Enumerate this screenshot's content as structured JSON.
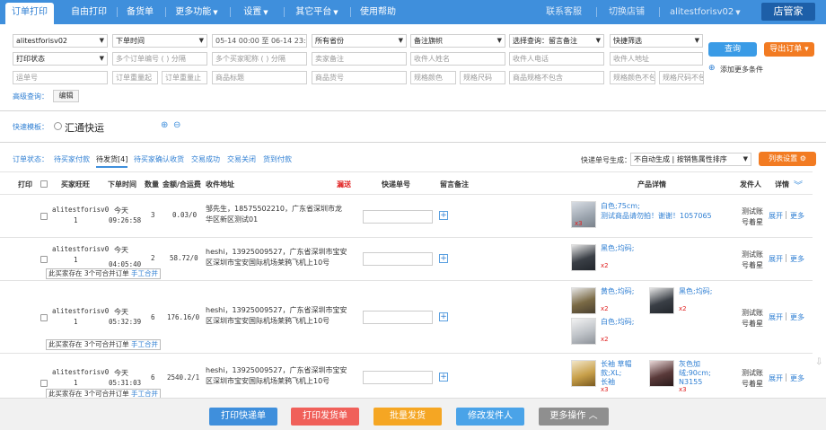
{
  "nav": {
    "tabs": [
      "订单打印",
      "自由打印",
      "备货单",
      "更多功能",
      "设置",
      "其它平台",
      "使用帮助"
    ],
    "right": [
      "联系客服",
      "切换店铺",
      "alitestforisv02"
    ],
    "brand": "店管家"
  },
  "filters": {
    "shop": "alitestforisv02",
    "time_type": "下单时间",
    "date_from": "05-14 00:00",
    "date_to_sep": "至",
    "date_to": "06-14 23:59",
    "province": "所有省份",
    "flag": "备注旗帜",
    "query_select": "选择查询：留言备注",
    "quick_filter": "快捷筛选",
    "print_status": "打印状态",
    "ph_order_no": "多个订单编号 ( ) 分隔",
    "ph_buyer": "多个买家昵称 ( ) 分隔",
    "ph_seller_note": "卖家备注",
    "ph_receiver_name": "收件人姓名",
    "ph_receiver_phone": "收件人电话",
    "ph_receiver_addr": "收件人地址",
    "ph_track": "运单号",
    "ph_weight_from": "订单重量起",
    "ph_weight_to": "订单重量止",
    "ph_title": "商品标题",
    "ph_goods_no": "商品货号",
    "ph_title2": "商品标题",
    "ph_goods_no2": "商品货号",
    "ph_color": "规格颜色",
    "ph_size": "规格尺码",
    "ph_spec_excl": "商品规格不包含",
    "ph_color_excl": "规格颜色不包",
    "ph_size_excl": "规格尺码不包",
    "query_btn": "查询",
    "export_btn": "导出订单 ▾",
    "add_condition": "添加更多条件",
    "advanced_label": "高级查询：",
    "edit_btn": "编辑"
  },
  "template": {
    "label": "快速模板：",
    "name": "汇通快运"
  },
  "status_bar": {
    "label": "订单状态：",
    "items": [
      "待买家付款",
      "待发货[4]",
      "待买家确认收货",
      "交易成功",
      "交易关闭",
      "货到付款"
    ],
    "track_gen_label": "快递单号生成：",
    "track_gen_value": "不自动生成",
    "sort_value": "按销售属性排序",
    "col_settings": "列表设置"
  },
  "table": {
    "headers": [
      "打印",
      "买家旺旺",
      "下单时间",
      "数量",
      "金额/合运费",
      "收件地址",
      "漏送",
      "快递单号",
      "留言备注",
      "产品详情",
      "发件人",
      "详情"
    ],
    "rows": [
      {
        "buyer": "alitestforisv0",
        "buyer_count": "1",
        "day": "今天",
        "time": "09:26:58",
        "qty": "3",
        "amount": "0.03/0",
        "address": [
          "邹先生，18575502210，广东省深圳市龙",
          "华区新区测试01"
        ],
        "products": [
          {
            "name": [
              "白色;75cm;",
              "测试商品请勿拍！谢谢！1057065"
            ],
            "qty": "x3"
          }
        ],
        "sender": [
          "测试账",
          "号着星"
        ],
        "actions": [
          "展开",
          "更多"
        ]
      },
      {
        "buyer": "alitestforisv0",
        "buyer_count": "1",
        "day": "今天",
        "time": "04:05:40",
        "qty": "2",
        "amount": "58.72/0",
        "address": [
          "heshi，13925009527，广东省深圳市宝安",
          "区深圳市宝安国际机场莱鸦飞机上10号"
        ],
        "merge_note": "此买家存在 3个可合并订单",
        "merge_link": "手工合并",
        "products": [
          {
            "name": [
              "黑色;均码;"
            ],
            "qty": "x2"
          },
          {
            "name": [
              "白色;均码;"
            ],
            "qty": "x2"
          }
        ],
        "sender": [
          "测试账",
          "号着星"
        ],
        "actions": [
          "展开",
          "更多"
        ]
      },
      {
        "buyer": "alitestforisv0",
        "buyer_count": "1",
        "day": "今天",
        "time": "05:32:39",
        "qty": "6",
        "amount": "176.16/0",
        "address": [
          "heshi，13925009527，广东省深圳市宝安",
          "区深圳市宝安国际机场莱鸦飞机上10号"
        ],
        "merge_note": "此买家存在 3个可合并订单",
        "merge_link": "手工合并",
        "products": [
          {
            "name": [
              "黄色;均码;"
            ],
            "qty": "x2"
          },
          {
            "name": [
              "黑色;均码;"
            ],
            "qty": "x2"
          },
          {
            "name": [
              "白色;均码;"
            ],
            "qty": "x2"
          }
        ],
        "sender": [
          "测试账",
          "号着星"
        ],
        "actions": [
          "展开",
          "更多"
        ]
      },
      {
        "buyer": "alitestforisv0",
        "buyer_count": "1",
        "day": "今天",
        "time": "05:31:03",
        "qty": "6",
        "amount": "2540.2/1",
        "address": [
          "heshi，13925009527，广东省深圳市宝安",
          "区深圳市宝安国际机场莱鸦飞机上10号"
        ],
        "merge_note": "此买家存在 3个可合并订单",
        "merge_link": "手工合并",
        "products": [
          {
            "name": [
              "长袖 草帽",
              "款;XL;",
              "长袖"
            ],
            "qty": "x3"
          },
          {
            "name": [
              "灰色加",
              "绒;90cm;",
              "N3155"
            ],
            "qty": "x3"
          }
        ],
        "sender": [
          "测试账",
          "号着星"
        ],
        "actions": [
          "展开",
          "更多"
        ]
      }
    ]
  },
  "footer": {
    "buttons": [
      "打印快递单",
      "打印发货单",
      "批量发货",
      "修改发件人",
      "更多操作 ︿"
    ],
    "colors": [
      "#3f8fdc",
      "#f0605a",
      "#f5a623",
      "#4aa3e8",
      "#8f8f8f"
    ]
  },
  "colors": {
    "accent": "#3f8fdc",
    "orange": "#f27b22",
    "link": "#2f7fd3",
    "qty_red": "#e02020"
  }
}
